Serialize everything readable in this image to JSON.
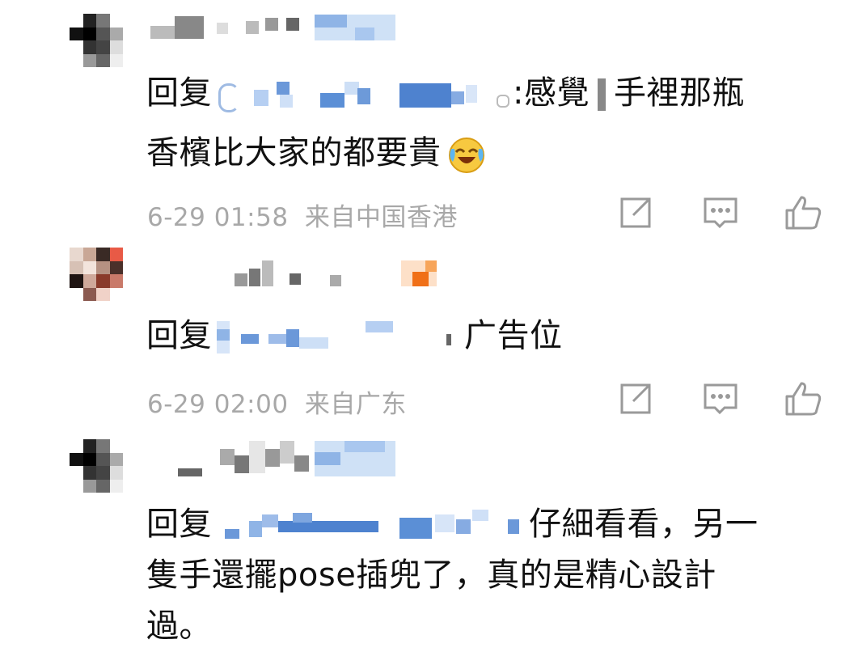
{
  "comments": [
    {
      "reply_prefix": "回复",
      "text_line1_after_name": ":感覺",
      "text_line1_end": "手裡那瓶",
      "text_line2": "香檳比大家的都要貴",
      "emoji": "laughing-crying-emoji",
      "time": "6-29 01:58",
      "location": "来自中国香港"
    },
    {
      "reply_prefix": "回复",
      "text_after_name": "广告位",
      "time": "6-29 02:00",
      "location": "来自广东"
    },
    {
      "reply_prefix": "回复",
      "text_line1_after_name": "仔細看看，另一",
      "text_line2": "隻手還擺pose插兜了，真的是精心設計",
      "text_line3": "過。"
    }
  ],
  "icons": {
    "share": "share-icon",
    "comment": "comment-icon",
    "like": "thumbs-up-icon"
  },
  "colors": {
    "meta_text": "#a8a8a8",
    "body_text": "#111111",
    "icon": "#9a9a9a",
    "mosaic_blue": "#5b8fd6"
  }
}
